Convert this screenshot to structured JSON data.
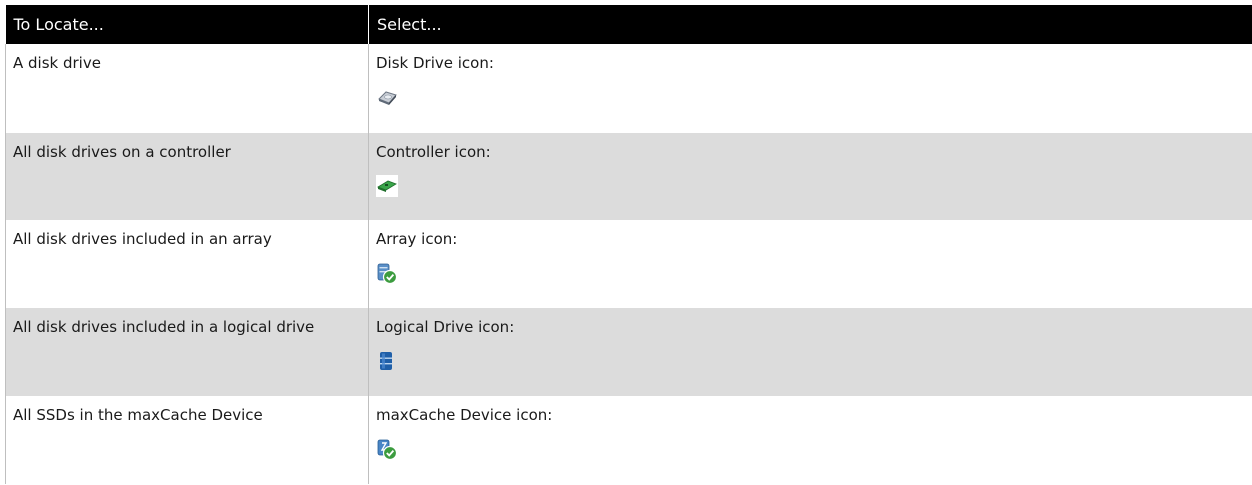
{
  "table": {
    "headers": [
      "To Locate...",
      "Select..."
    ],
    "rows": [
      {
        "locate": "A disk drive",
        "select": "Disk Drive icon:",
        "icon": "disk-drive-icon"
      },
      {
        "locate": "All disk drives on a controller",
        "select": "Controller icon:",
        "icon": "controller-icon"
      },
      {
        "locate": "All disk drives included in an array",
        "select": "Array icon:",
        "icon": "array-icon"
      },
      {
        "locate": "All disk drives included in a logical drive",
        "select": "Logical Drive icon:",
        "icon": "logical-drive-icon"
      },
      {
        "locate": "All SSDs in the maxCache Device",
        "select": "maxCache Device icon:",
        "icon": "maxcache-device-icon"
      }
    ]
  },
  "colors": {
    "header_bg": "#000000",
    "header_text": "#ffffff",
    "alt_row_bg": "#dcdcdc"
  }
}
